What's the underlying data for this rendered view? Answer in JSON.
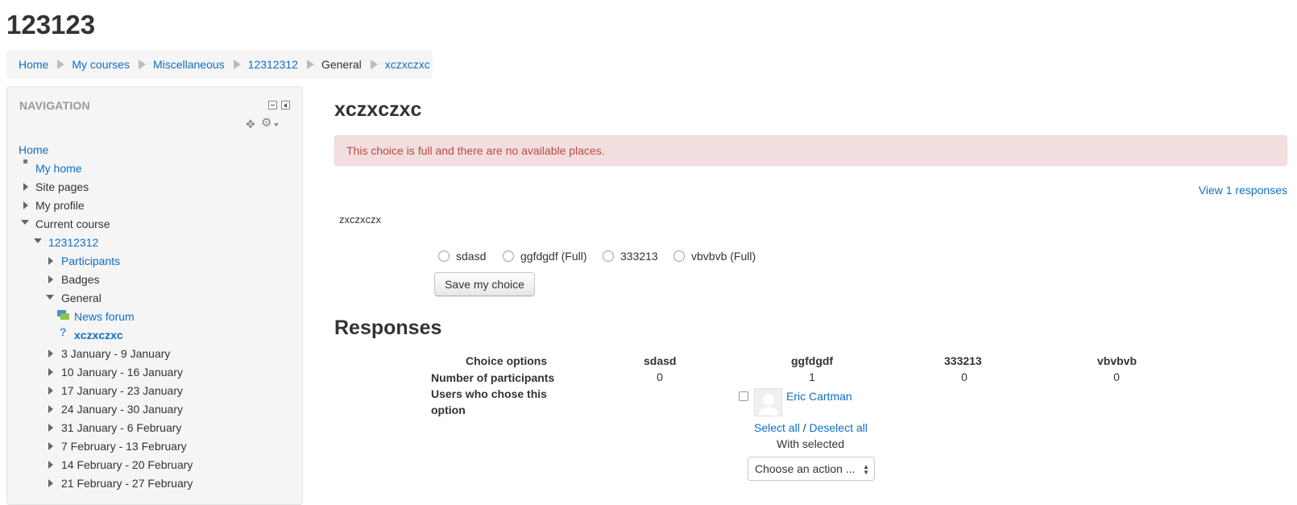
{
  "page": {
    "course_title": "123123",
    "breadcrumb": [
      "Home",
      "My courses",
      "Miscellaneous",
      "12312312",
      "General",
      "xczxczxc"
    ]
  },
  "navigation": {
    "title": "NAVIGATION",
    "items": {
      "home": "Home",
      "my_home": "My home",
      "site_pages": "Site pages",
      "my_profile": "My profile",
      "current_course": "Current course",
      "course": "12312312",
      "participants": "Participants",
      "badges": "Badges",
      "general": "General",
      "news_forum": "News forum",
      "activity": "xczxczxc",
      "weeks": [
        "3 January - 9 January",
        "10 January - 16 January",
        "17 January - 23 January",
        "24 January - 30 January",
        "31 January - 6 February",
        "7 February - 13 February",
        "14 February - 20 February",
        "21 February - 27 February"
      ]
    }
  },
  "main": {
    "heading": "xczxczxc",
    "alert": "This choice is full and there are no available places.",
    "view_responses": "View 1 responses",
    "intro": "zxczxczx",
    "options": [
      "sdasd",
      "ggfdgdf (Full)",
      "333213",
      "vbvbvb (Full)"
    ],
    "save_button": "Save my choice",
    "responses_heading": "Responses",
    "responses_table": {
      "header_label": "Choice options",
      "columns": [
        "sdasd",
        "ggfdgdf",
        "333213",
        "vbvbvb"
      ],
      "row_participants_label": "Number of participants",
      "participants": [
        "0",
        "1",
        "0",
        "0"
      ],
      "row_users_label_line1": "Users who chose this",
      "row_users_label_line2": "option"
    },
    "user_name": "Eric Cartman",
    "select_all": "Select all",
    "slash": " / ",
    "deselect_all": "Deselect all",
    "with_selected": "With selected",
    "action_select": "Choose an action ..."
  }
}
